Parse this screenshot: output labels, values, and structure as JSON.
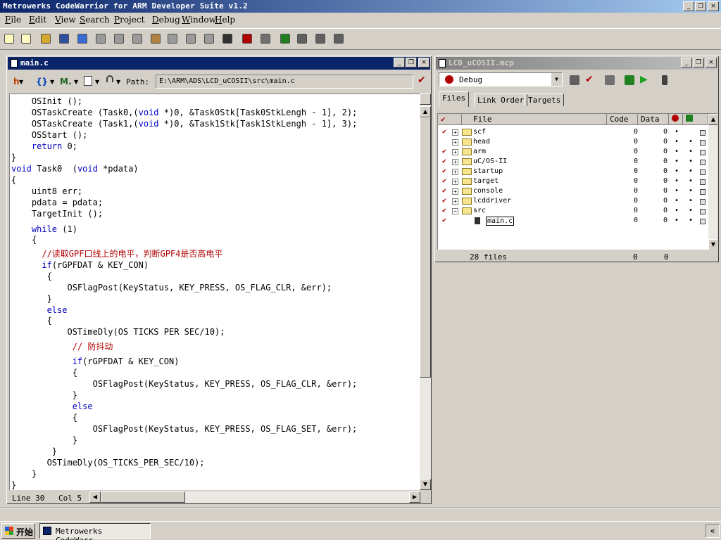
{
  "app": {
    "title": "Metrowerks CodeWarrior for ARM Developer Suite v1.2",
    "buttons": {
      "minimize": "_",
      "restore": "❐",
      "close": "×"
    }
  },
  "menu": [
    "File",
    "Edit",
    "View",
    "Search",
    "Project",
    "Debug",
    "Window",
    "Help"
  ],
  "toolbar": {
    "icons": [
      "new-project-icon",
      "new-file-icon",
      "open-icon",
      "save-icon",
      "undo-icon",
      "redo-icon",
      "cut-icon",
      "copy-icon",
      "paste-icon",
      "find-icon",
      "find-next-icon",
      "replace-icon",
      "file-compare-icon",
      "check-syntax-icon",
      "make-icon",
      "debug-icon",
      "stop-icon",
      "settings-icon",
      "project-settings-icon"
    ],
    "colors": [
      "#fdf7c0",
      "#fdf7c0",
      "#d4a830",
      "#3050a0",
      "#3a6ad0",
      "#9a9a9a",
      "#9a9a9a",
      "#9a9a9a",
      "#b08040",
      "#9a9a9a",
      "#9a9a9a",
      "#9a9a9a",
      "#303030",
      "#b00000",
      "#707070",
      "#208020",
      "#606060",
      "#606060",
      "#606060"
    ]
  },
  "editor": {
    "title": "main.c",
    "tools": {
      "header_menu": "h",
      "functions_menu": "{}",
      "markers_menu": "M.",
      "path_label": "Path:"
    },
    "path": "E:\\ARM\\ADS\\LCD_uCOSII\\src\\main.c",
    "lines": [
      [
        {
          "t": "    OSInit ();"
        }
      ],
      [
        {
          "t": "    OSTaskCreate (Task0,("
        },
        {
          "t": "void",
          "k": 1
        },
        {
          "t": " *)0, &Task0Stk[Task0StkLengh - 1], 2);"
        }
      ],
      [
        {
          "t": "    OSTaskCreate (Task1,("
        },
        {
          "t": "void",
          "k": 1
        },
        {
          "t": " *)0, &Task1Stk[Task1StkLengh - 1], 3);"
        }
      ],
      [
        {
          "t": "    OSStart ();"
        }
      ],
      [
        {
          "t": "    "
        },
        {
          "t": "return",
          "k": 1
        },
        {
          "t": " 0;"
        }
      ],
      [
        {
          "t": "}"
        }
      ],
      [
        {
          "t": "void",
          "k": 1
        },
        {
          "t": " Task0  ("
        },
        {
          "t": "void",
          "k": 1
        },
        {
          "t": " *pdata)"
        }
      ],
      [
        {
          "t": "{"
        }
      ],
      [
        {
          "t": "    uint8 err;"
        }
      ],
      [
        {
          "t": "    pdata = pdata;"
        }
      ],
      [
        {
          "t": "    TargetInit ();"
        }
      ],
      [
        {
          "t": "    "
        },
        {
          "t": "while",
          "k": 1
        },
        {
          "t": " (1)"
        }
      ],
      [
        {
          "t": "    {"
        }
      ],
      [
        {
          "t": "      //读取GPF口线上的电平，判断GPF4是否高电平",
          "c": 1
        }
      ],
      [
        {
          "t": "      "
        },
        {
          "t": "if",
          "k": 1
        },
        {
          "t": "(rGPFDAT & KEY_CON)"
        }
      ],
      [
        {
          "t": "       {"
        }
      ],
      [
        {
          "t": "           OSFlagPost(KeyStatus, KEY_PRESS, OS_FLAG_CLR, &err);"
        }
      ],
      [
        {
          "t": "       }"
        }
      ],
      [
        {
          "t": "       "
        },
        {
          "t": "else",
          "k": 1
        }
      ],
      [
        {
          "t": "       {"
        }
      ],
      [
        {
          "t": "           OSTimeDly(OS TICKS PER SEC/10);"
        }
      ],
      [
        {
          "t": "            // 防抖动",
          "c": 1
        }
      ],
      [
        {
          "t": "            "
        },
        {
          "t": "if",
          "k": 1
        },
        {
          "t": "(rGPFDAT & KEY_CON)"
        }
      ],
      [
        {
          "t": "            {"
        }
      ],
      [
        {
          "t": "                OSFlagPost(KeyStatus, KEY_PRESS, OS_FLAG_CLR, &err);"
        }
      ],
      [
        {
          "t": "            }"
        }
      ],
      [
        {
          "t": "            "
        },
        {
          "t": "else",
          "k": 1
        }
      ],
      [
        {
          "t": "            {"
        }
      ],
      [
        {
          "t": "                OSFlagPost(KeyStatus, KEY_PRESS, OS_FLAG_SET, &err);"
        }
      ],
      [
        {
          "t": "            }"
        }
      ],
      [
        {
          "t": "        }"
        }
      ],
      [
        {
          "t": "       OSTimeDly(OS_TICKS_PER_SEC/10);"
        }
      ],
      [
        {
          "t": "    }"
        }
      ],
      [
        {
          "t": "}"
        }
      ]
    ],
    "status": {
      "line": "Line 30",
      "col": "Col 5"
    }
  },
  "project": {
    "title": "LCD_uCOSII.mcp",
    "target": "Debug",
    "tabs": [
      "Files",
      "Link Order",
      "Targets"
    ],
    "columns": {
      "check": "✔",
      "file": "File",
      "code": "Code",
      "data": "Data"
    },
    "rows": [
      {
        "name": "scf",
        "code": "0",
        "data": "0",
        "checked": true,
        "expand": "+",
        "dbg": "•",
        "dbg2": ""
      },
      {
        "name": "head",
        "code": "0",
        "data": "0",
        "checked": false,
        "expand": "+",
        "dbg": "•",
        "dbg2": "•"
      },
      {
        "name": "arm",
        "code": "0",
        "data": "0",
        "checked": true,
        "expand": "+",
        "dbg": "•",
        "dbg2": "•"
      },
      {
        "name": "uC/OS-II",
        "code": "0",
        "data": "0",
        "checked": true,
        "expand": "+",
        "dbg": "•",
        "dbg2": "•"
      },
      {
        "name": "startup",
        "code": "0",
        "data": "0",
        "checked": true,
        "expand": "+",
        "dbg": "•",
        "dbg2": "•"
      },
      {
        "name": "target",
        "code": "0",
        "data": "0",
        "checked": true,
        "expand": "+",
        "dbg": "•",
        "dbg2": "•"
      },
      {
        "name": "console",
        "code": "0",
        "data": "0",
        "checked": true,
        "expand": "+",
        "dbg": "•",
        "dbg2": "•"
      },
      {
        "name": "lcddriver",
        "code": "0",
        "data": "0",
        "checked": true,
        "expand": "+",
        "dbg": "•",
        "dbg2": "•"
      },
      {
        "name": "src",
        "code": "0",
        "data": "0",
        "checked": true,
        "expand": "−",
        "dbg": "•",
        "dbg2": "•"
      },
      {
        "name": "main.c",
        "code": "0",
        "data": "0",
        "checked": true,
        "expand": "",
        "dbg": "•",
        "dbg2": "•",
        "child": true
      }
    ],
    "footer": {
      "files": "28 files",
      "code": "0",
      "data": "0"
    }
  },
  "taskbar": {
    "start": "开始",
    "item": "Metrowerks CodeWarr...",
    "tray": "«"
  }
}
